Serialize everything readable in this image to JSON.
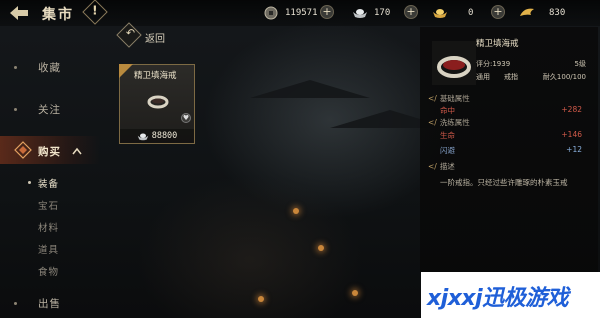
{
  "topbar": {
    "title": "集市",
    "help_symbol": "!",
    "currencies": [
      {
        "icon": "coin-icon",
        "value": "119571"
      },
      {
        "icon": "silver-ingot-icon",
        "value": "170"
      },
      {
        "icon": "gold-ingot-icon",
        "value": "0"
      },
      {
        "icon": "wing-token-icon",
        "value": "830"
      }
    ],
    "plus_symbol": "+"
  },
  "nav": {
    "items": [
      {
        "label": "收藏"
      },
      {
        "label": "关注"
      },
      {
        "label": "购买"
      },
      {
        "label": "出售"
      }
    ],
    "sub_items": [
      {
        "label": "装备",
        "active": true
      },
      {
        "label": "宝石"
      },
      {
        "label": "材料"
      },
      {
        "label": "道具"
      },
      {
        "label": "食物"
      }
    ]
  },
  "back": {
    "label": "返回"
  },
  "listing": {
    "name": "精卫填海戒",
    "price": "88800"
  },
  "detail": {
    "name": "精卫填海戒",
    "score": "评分:1939",
    "level": "5级",
    "usage": "通用",
    "slot": "戒指",
    "durability": "耐久100/100",
    "basic_title": "基础属性",
    "basic_stats": [
      {
        "label": "命中",
        "value": "+282"
      }
    ],
    "refine_title": "洗练属性",
    "refine_stats": [
      {
        "label": "生命",
        "value": "+146"
      },
      {
        "label": "闪避",
        "value": "+12"
      }
    ],
    "desc_title": "描述",
    "desc_text": "一阶戒指。只经过些许雕琢的朴素玉戒"
  },
  "watermark": "xjxxj迅极游戏",
  "colors": {
    "stat_red": "#d25a4a",
    "stat_blue": "#8ab0de",
    "accent_gold": "#b98a3e",
    "watermark_blue": "#1f5fd8"
  }
}
